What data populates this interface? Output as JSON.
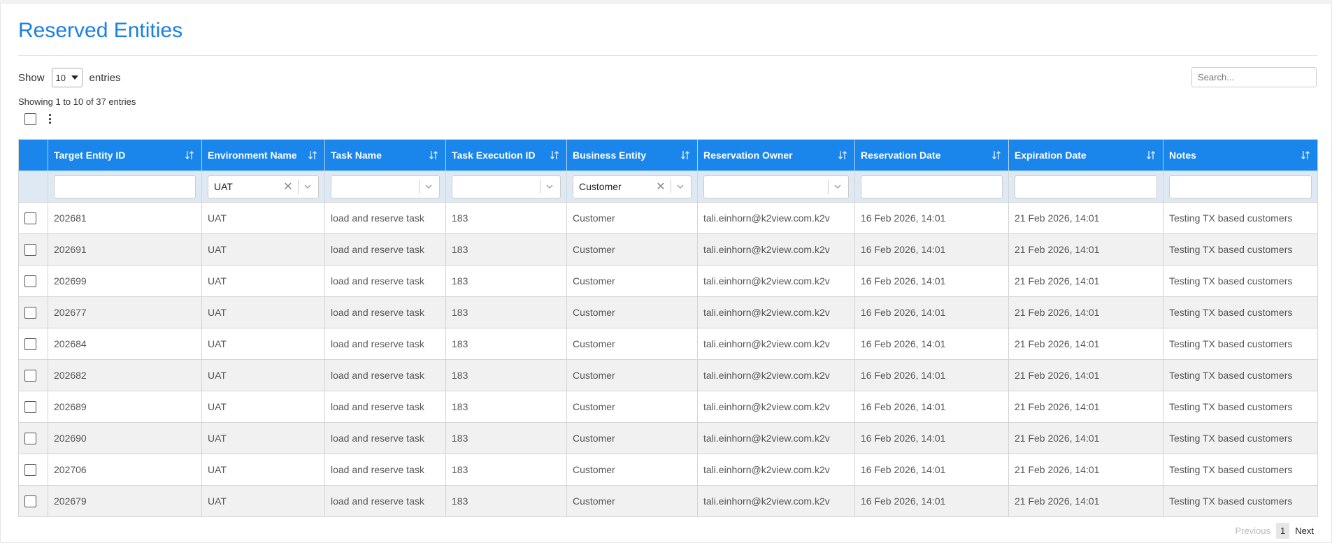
{
  "page": {
    "title": "Reserved Entities"
  },
  "length": {
    "show_label": "Show",
    "value": "10",
    "entries_label": "entries"
  },
  "search": {
    "placeholder": "Search..."
  },
  "info": "Showing 1 to 10 of 37 entries",
  "colors": {
    "accent": "#1a85ea",
    "title": "#1a7fe0",
    "filter_bg": "#dfe9f4",
    "stripe": "#f1f1f1"
  },
  "columns": [
    "Target Entity ID",
    "Environment Name",
    "Task Name",
    "Task Execution ID",
    "Business Entity",
    "Reservation Owner",
    "Reservation Date",
    "Expiration Date",
    "Notes"
  ],
  "filters": {
    "environment": "UAT",
    "business_entity": "Customer"
  },
  "rows": [
    [
      "202681",
      "UAT",
      "load and reserve task",
      "183",
      "Customer",
      "tali.einhorn@k2view.com.k2v",
      "16 Feb 2026, 14:01",
      "21 Feb 2026, 14:01",
      "Testing TX based customers"
    ],
    [
      "202691",
      "UAT",
      "load and reserve task",
      "183",
      "Customer",
      "tali.einhorn@k2view.com.k2v",
      "16 Feb 2026, 14:01",
      "21 Feb 2026, 14:01",
      "Testing TX based customers"
    ],
    [
      "202699",
      "UAT",
      "load and reserve task",
      "183",
      "Customer",
      "tali.einhorn@k2view.com.k2v",
      "16 Feb 2026, 14:01",
      "21 Feb 2026, 14:01",
      "Testing TX based customers"
    ],
    [
      "202677",
      "UAT",
      "load and reserve task",
      "183",
      "Customer",
      "tali.einhorn@k2view.com.k2v",
      "16 Feb 2026, 14:01",
      "21 Feb 2026, 14:01",
      "Testing TX based customers"
    ],
    [
      "202684",
      "UAT",
      "load and reserve task",
      "183",
      "Customer",
      "tali.einhorn@k2view.com.k2v",
      "16 Feb 2026, 14:01",
      "21 Feb 2026, 14:01",
      "Testing TX based customers"
    ],
    [
      "202682",
      "UAT",
      "load and reserve task",
      "183",
      "Customer",
      "tali.einhorn@k2view.com.k2v",
      "16 Feb 2026, 14:01",
      "21 Feb 2026, 14:01",
      "Testing TX based customers"
    ],
    [
      "202689",
      "UAT",
      "load and reserve task",
      "183",
      "Customer",
      "tali.einhorn@k2view.com.k2v",
      "16 Feb 2026, 14:01",
      "21 Feb 2026, 14:01",
      "Testing TX based customers"
    ],
    [
      "202690",
      "UAT",
      "load and reserve task",
      "183",
      "Customer",
      "tali.einhorn@k2view.com.k2v",
      "16 Feb 2026, 14:01",
      "21 Feb 2026, 14:01",
      "Testing TX based customers"
    ],
    [
      "202706",
      "UAT",
      "load and reserve task",
      "183",
      "Customer",
      "tali.einhorn@k2view.com.k2v",
      "16 Feb 2026, 14:01",
      "21 Feb 2026, 14:01",
      "Testing TX based customers"
    ],
    [
      "202679",
      "UAT",
      "load and reserve task",
      "183",
      "Customer",
      "tali.einhorn@k2view.com.k2v",
      "16 Feb 2026, 14:01",
      "21 Feb 2026, 14:01",
      "Testing TX based customers"
    ]
  ],
  "pagination": {
    "previous": "Previous",
    "current": "1",
    "next": "Next"
  },
  "icons": {
    "sort": "sort-arrows-icon",
    "clear": "clear-x-icon",
    "dropdown": "chevron-down-icon",
    "menu": "kebab-menu-icon"
  }
}
